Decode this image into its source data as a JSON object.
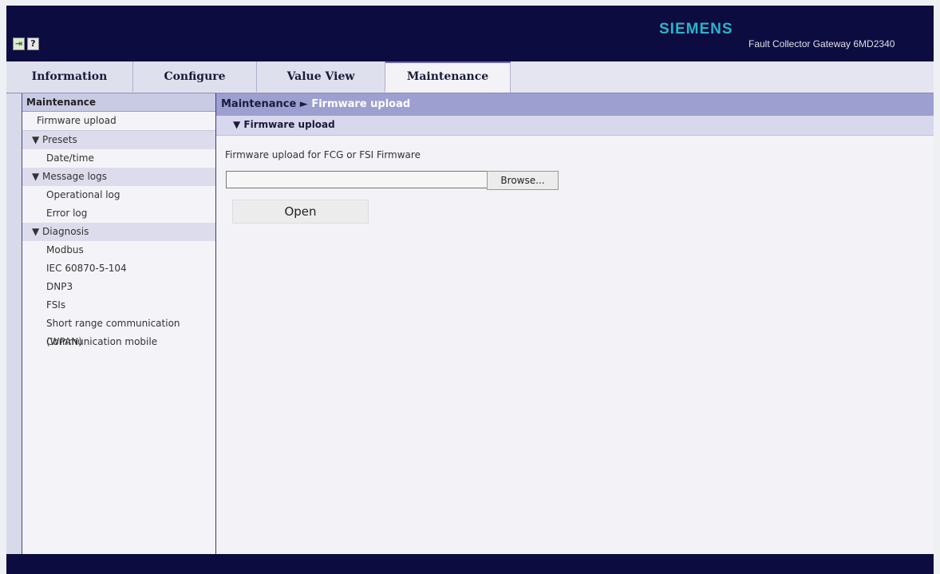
{
  "header": {
    "brand": "SIEMENS",
    "product": "Fault Collector Gateway 6MD2340",
    "icons": [
      "exit-icon",
      "help-icon"
    ],
    "help_glyph": "?"
  },
  "tabs": [
    {
      "label": "Information",
      "active": false
    },
    {
      "label": "Configure",
      "active": false
    },
    {
      "label": "Value View",
      "active": false
    },
    {
      "label": "Maintenance",
      "active": true
    }
  ],
  "sidebar": {
    "title": "Maintenance",
    "items": [
      {
        "label": "Firmware upload"
      },
      {
        "group": "▼ Presets"
      },
      {
        "label": "Date/time"
      },
      {
        "group": "▼ Message logs"
      },
      {
        "label": "Operational log"
      },
      {
        "label": "Error log"
      },
      {
        "group": "▼ Diagnosis"
      },
      {
        "label": "Modbus"
      },
      {
        "label": "IEC 60870-5-104"
      },
      {
        "label": "DNP3"
      },
      {
        "label": "FSIs"
      },
      {
        "label": "Short range communication (WPAN)"
      },
      {
        "label": "Communication mobile"
      }
    ]
  },
  "breadcrumb": {
    "parent": "Maintenance",
    "separator": "►",
    "current": "Firmware upload"
  },
  "section": {
    "title": "▼ Firmware upload",
    "description": "Firmware upload for FCG or FSI Firmware",
    "file_value": "",
    "browse_label": "Browse...",
    "open_label": "Open"
  },
  "colors": {
    "header_bg": "#0c0c40",
    "brand": "#2bb3c9",
    "breadcrumb_bg": "#9c9fcf",
    "section_bg": "#d7d8ed"
  }
}
